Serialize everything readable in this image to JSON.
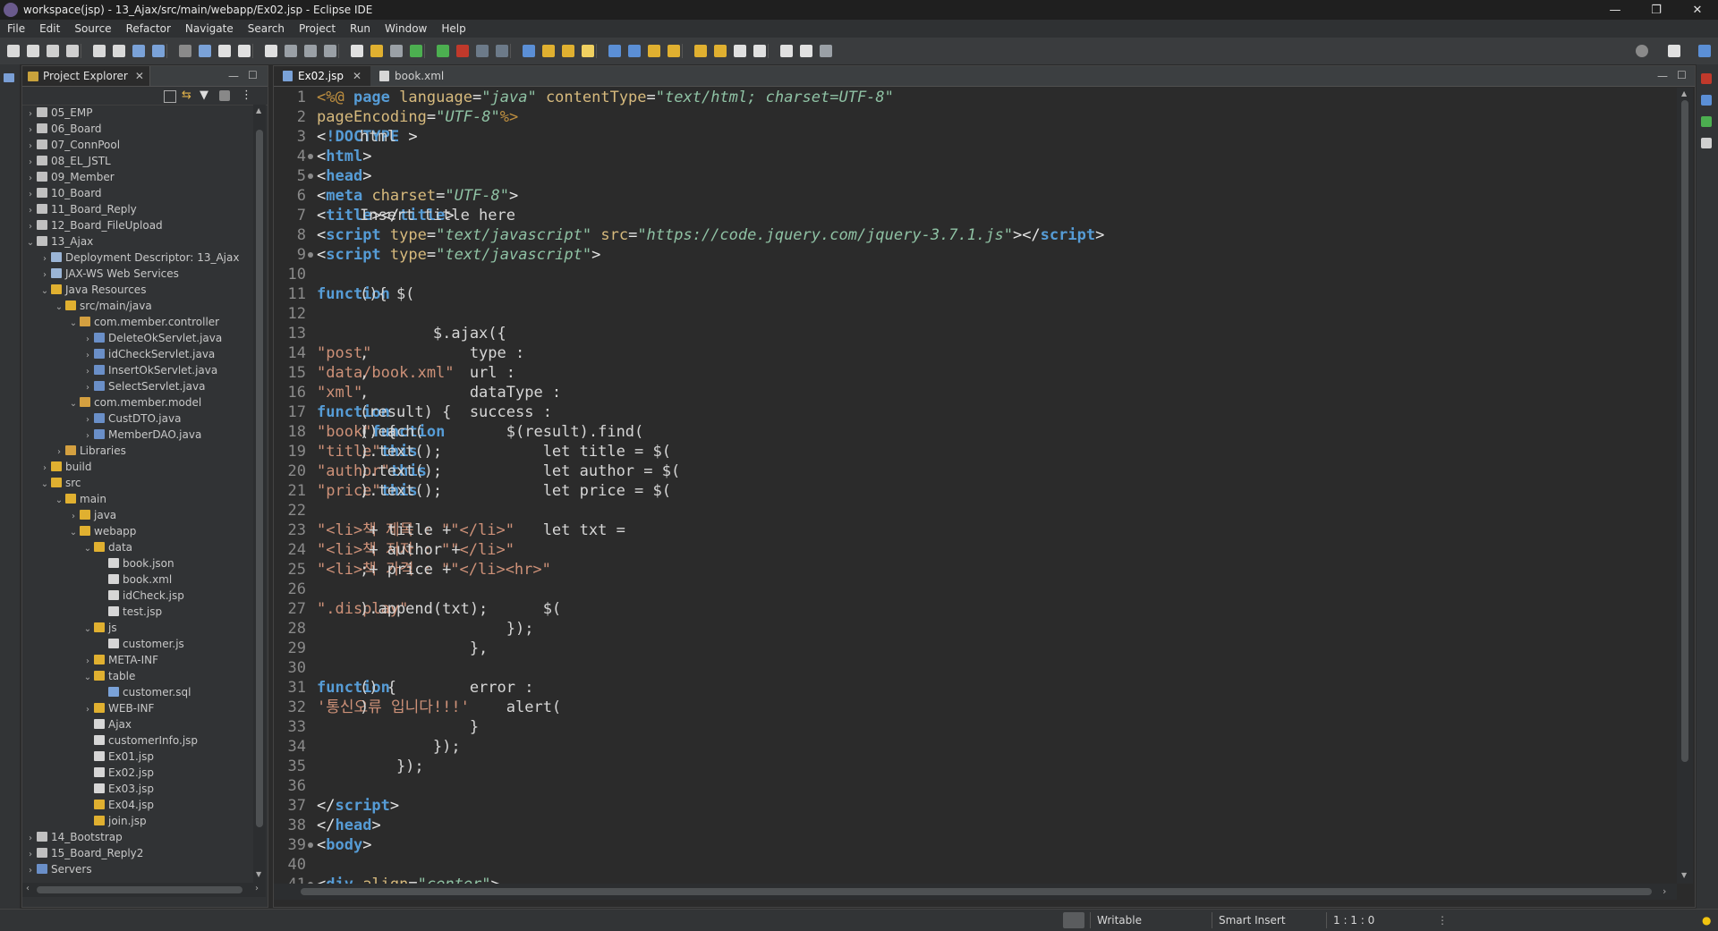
{
  "window": {
    "title": "workspace(jsp) - 13_Ajax/src/main/webapp/Ex02.jsp - Eclipse IDE",
    "minimize": "—",
    "restore": "❐",
    "close": "✕"
  },
  "menu": [
    "File",
    "Edit",
    "Source",
    "Refactor",
    "Navigate",
    "Search",
    "Project",
    "Run",
    "Window",
    "Help"
  ],
  "explorer": {
    "tab_label": "Project Explorer",
    "tree": [
      {
        "label": "05_EMP",
        "depth": 0,
        "arrow": "›",
        "kind": "project"
      },
      {
        "label": "06_Board",
        "depth": 0,
        "arrow": "›",
        "kind": "project"
      },
      {
        "label": "07_ConnPool",
        "depth": 0,
        "arrow": "›",
        "kind": "project"
      },
      {
        "label": "08_EL_JSTL",
        "depth": 0,
        "arrow": "›",
        "kind": "project"
      },
      {
        "label": "09_Member",
        "depth": 0,
        "arrow": "›",
        "kind": "project"
      },
      {
        "label": "10_Board",
        "depth": 0,
        "arrow": "›",
        "kind": "project"
      },
      {
        "label": "11_Board_Reply",
        "depth": 0,
        "arrow": "›",
        "kind": "project"
      },
      {
        "label": "12_Board_FileUpload",
        "depth": 0,
        "arrow": "›",
        "kind": "project"
      },
      {
        "label": "13_Ajax",
        "depth": 0,
        "arrow": "⌄",
        "kind": "project"
      },
      {
        "label": "Deployment Descriptor: 13_Ajax",
        "depth": 1,
        "arrow": "›",
        "kind": "deploy"
      },
      {
        "label": "JAX-WS Web Services",
        "depth": 1,
        "arrow": "›",
        "kind": "ws"
      },
      {
        "label": "Java Resources",
        "depth": 1,
        "arrow": "⌄",
        "kind": "jres"
      },
      {
        "label": "src/main/java",
        "depth": 2,
        "arrow": "⌄",
        "kind": "srcfolder"
      },
      {
        "label": "com.member.controller",
        "depth": 3,
        "arrow": "⌄",
        "kind": "package"
      },
      {
        "label": "DeleteOkServlet.java",
        "depth": 4,
        "arrow": "›",
        "kind": "java"
      },
      {
        "label": "idCheckServlet.java",
        "depth": 4,
        "arrow": "›",
        "kind": "java"
      },
      {
        "label": "InsertOkServlet.java",
        "depth": 4,
        "arrow": "›",
        "kind": "java"
      },
      {
        "label": "SelectServlet.java",
        "depth": 4,
        "arrow": "›",
        "kind": "java"
      },
      {
        "label": "com.member.model",
        "depth": 3,
        "arrow": "⌄",
        "kind": "package"
      },
      {
        "label": "CustDTO.java",
        "depth": 4,
        "arrow": "›",
        "kind": "java"
      },
      {
        "label": "MemberDAO.java",
        "depth": 4,
        "arrow": "›",
        "kind": "java"
      },
      {
        "label": "Libraries",
        "depth": 2,
        "arrow": "›",
        "kind": "lib"
      },
      {
        "label": "build",
        "depth": 1,
        "arrow": "›",
        "kind": "folder"
      },
      {
        "label": "src",
        "depth": 1,
        "arrow": "⌄",
        "kind": "folder"
      },
      {
        "label": "main",
        "depth": 2,
        "arrow": "⌄",
        "kind": "folder"
      },
      {
        "label": "java",
        "depth": 3,
        "arrow": "›",
        "kind": "folder"
      },
      {
        "label": "webapp",
        "depth": 3,
        "arrow": "⌄",
        "kind": "folder"
      },
      {
        "label": "data",
        "depth": 4,
        "arrow": "⌄",
        "kind": "folder"
      },
      {
        "label": "book.json",
        "depth": 5,
        "arrow": "",
        "kind": "file"
      },
      {
        "label": "book.xml",
        "depth": 5,
        "arrow": "",
        "kind": "xml"
      },
      {
        "label": "idCheck.jsp",
        "depth": 5,
        "arrow": "",
        "kind": "file"
      },
      {
        "label": "test.jsp",
        "depth": 5,
        "arrow": "",
        "kind": "file"
      },
      {
        "label": "js",
        "depth": 4,
        "arrow": "⌄",
        "kind": "folder"
      },
      {
        "label": "customer.js",
        "depth": 5,
        "arrow": "",
        "kind": "file"
      },
      {
        "label": "META-INF",
        "depth": 4,
        "arrow": "›",
        "kind": "folder"
      },
      {
        "label": "table",
        "depth": 4,
        "arrow": "⌄",
        "kind": "folder"
      },
      {
        "label": "customer.sql",
        "depth": 5,
        "arrow": "",
        "kind": "sql"
      },
      {
        "label": "WEB-INF",
        "depth": 4,
        "arrow": "›",
        "kind": "folder"
      },
      {
        "label": "Ajax",
        "depth": 4,
        "arrow": "",
        "kind": "file"
      },
      {
        "label": "customerInfo.jsp",
        "depth": 4,
        "arrow": "",
        "kind": "file"
      },
      {
        "label": "Ex01.jsp",
        "depth": 4,
        "arrow": "",
        "kind": "file"
      },
      {
        "label": "Ex02.jsp",
        "depth": 4,
        "arrow": "",
        "kind": "file"
      },
      {
        "label": "Ex03.jsp",
        "depth": 4,
        "arrow": "",
        "kind": "file"
      },
      {
        "label": "Ex04.jsp",
        "depth": 4,
        "arrow": "",
        "kind": "jspwarn"
      },
      {
        "label": "join.jsp",
        "depth": 4,
        "arrow": "",
        "kind": "jspwarn"
      },
      {
        "label": "14_Bootstrap",
        "depth": 0,
        "arrow": "›",
        "kind": "project"
      },
      {
        "label": "15_Board_Reply2",
        "depth": 0,
        "arrow": "›",
        "kind": "project"
      },
      {
        "label": "Servers",
        "depth": 0,
        "arrow": "›",
        "kind": "servers"
      }
    ]
  },
  "editor": {
    "tabs": [
      {
        "label": "Ex02.jsp",
        "active": true
      },
      {
        "label": "book.xml",
        "active": false
      }
    ],
    "lines": [
      {
        "n": "1",
        "fold": false,
        "segs": [
          [
            "jsp",
            "<%@ "
          ],
          [
            "kw",
            "page "
          ],
          [
            "attr",
            "language"
          ],
          [
            "tag",
            "="
          ],
          [
            "aval",
            "\"java\" "
          ],
          [
            "attr",
            "contentType"
          ],
          [
            "tag",
            "="
          ],
          [
            "aval",
            "\"text/html; charset=UTF-8\""
          ]
        ]
      },
      {
        "n": "2",
        "fold": false,
        "segs": [
          [
            "tx",
            "    "
          ],
          [
            "attr",
            "pageEncoding"
          ],
          [
            "tag",
            "="
          ],
          [
            "aval",
            "\"UTF-8\""
          ],
          [
            "jsp",
            "%>"
          ]
        ]
      },
      {
        "n": "3",
        "fold": false,
        "segs": [
          [
            "tag",
            "<"
          ],
          [
            "tagn",
            "!DOCTYPE "
          ],
          [
            "tx",
            "html"
          ],
          [
            "tag",
            ">"
          ]
        ]
      },
      {
        "n": "4",
        "fold": true,
        "segs": [
          [
            "tag",
            "<"
          ],
          [
            "tagn",
            "html"
          ],
          [
            "tag",
            ">"
          ]
        ]
      },
      {
        "n": "5",
        "fold": true,
        "segs": [
          [
            "tag",
            "<"
          ],
          [
            "tagn",
            "head"
          ],
          [
            "tag",
            ">"
          ]
        ]
      },
      {
        "n": "6",
        "fold": false,
        "segs": [
          [
            "tag",
            "<"
          ],
          [
            "tagn",
            "meta "
          ],
          [
            "attr",
            "charset"
          ],
          [
            "tag",
            "="
          ],
          [
            "aval",
            "\"UTF-8\""
          ],
          [
            "tag",
            ">"
          ]
        ]
      },
      {
        "n": "7",
        "fold": false,
        "segs": [
          [
            "tag",
            "<"
          ],
          [
            "tagn",
            "title"
          ],
          [
            "tag",
            ">"
          ],
          [
            "tx",
            "Insert title here"
          ],
          [
            "tag",
            "</"
          ],
          [
            "tagn",
            "title"
          ],
          [
            "tag",
            ">"
          ]
        ]
      },
      {
        "n": "8",
        "fold": false,
        "segs": [
          [
            "tag",
            "<"
          ],
          [
            "tagn",
            "script "
          ],
          [
            "attr",
            "type"
          ],
          [
            "tag",
            "="
          ],
          [
            "aval",
            "\"text/javascript\" "
          ],
          [
            "attr",
            "src"
          ],
          [
            "tag",
            "="
          ],
          [
            "aval",
            "\"https://code.jquery.com/jquery-3.7.1.js\""
          ],
          [
            "tag",
            "></"
          ],
          [
            "tagn",
            "script"
          ],
          [
            "tag",
            ">"
          ]
        ]
      },
      {
        "n": "9",
        "fold": true,
        "segs": [
          [
            "tag",
            "<"
          ],
          [
            "tagn",
            "script "
          ],
          [
            "attr",
            "type"
          ],
          [
            "tag",
            "="
          ],
          [
            "aval",
            "\"text/javascript\""
          ],
          [
            "tag",
            ">"
          ]
        ]
      },
      {
        "n": "10",
        "fold": false,
        "segs": []
      },
      {
        "n": "11",
        "fold": false,
        "segs": [
          [
            "tx",
            "    $("
          ],
          [
            "kw",
            "function"
          ],
          [
            "tx",
            "(){"
          ]
        ]
      },
      {
        "n": "12",
        "fold": false,
        "segs": []
      },
      {
        "n": "13",
        "fold": false,
        "segs": [
          [
            "tx",
            "        $.ajax({"
          ]
        ]
      },
      {
        "n": "14",
        "fold": false,
        "segs": [
          [
            "tx",
            "            type : "
          ],
          [
            "str",
            "\"post\""
          ],
          [
            "tx",
            ","
          ]
        ]
      },
      {
        "n": "15",
        "fold": false,
        "segs": [
          [
            "tx",
            "            url : "
          ],
          [
            "str",
            "\"data/book.xml\""
          ],
          [
            "tx",
            ","
          ]
        ]
      },
      {
        "n": "16",
        "fold": false,
        "segs": [
          [
            "tx",
            "            dataType : "
          ],
          [
            "str",
            "\"xml\""
          ],
          [
            "tx",
            ","
          ]
        ]
      },
      {
        "n": "17",
        "fold": false,
        "segs": [
          [
            "tx",
            "            success : "
          ],
          [
            "kw",
            "function"
          ],
          [
            "tx",
            "(result) {"
          ]
        ]
      },
      {
        "n": "18",
        "fold": false,
        "segs": [
          [
            "tx",
            "                $(result).find("
          ],
          [
            "str",
            "\"book\""
          ],
          [
            "tx",
            ").each("
          ],
          [
            "kw",
            "function"
          ],
          [
            "tx",
            "() {"
          ]
        ]
      },
      {
        "n": "19",
        "fold": false,
        "segs": [
          [
            "tx",
            "                    let title = $("
          ],
          [
            "str",
            "\"title\""
          ],
          [
            "tx",
            ", "
          ],
          [
            "kw",
            "this"
          ],
          [
            "tx",
            ").text();"
          ]
        ]
      },
      {
        "n": "20",
        "fold": false,
        "segs": [
          [
            "tx",
            "                    let author = $("
          ],
          [
            "str",
            "\"author\""
          ],
          [
            "tx",
            ", "
          ],
          [
            "kw",
            "this"
          ],
          [
            "tx",
            ").text();"
          ]
        ]
      },
      {
        "n": "21",
        "fold": false,
        "segs": [
          [
            "tx",
            "                    let price = $("
          ],
          [
            "str",
            "\"price\""
          ],
          [
            "tx",
            ", "
          ],
          [
            "kw",
            "this"
          ],
          [
            "tx",
            ").text();"
          ]
        ]
      },
      {
        "n": "22",
        "fold": false,
        "segs": []
      },
      {
        "n": "23",
        "fold": false,
        "segs": [
          [
            "tx",
            "                    let txt = "
          ],
          [
            "str",
            "\"<li>책 제목 : \""
          ],
          [
            "tx",
            " + title + "
          ],
          [
            "str",
            "\"</li>\""
          ],
          [
            "tx",
            " +"
          ]
        ]
      },
      {
        "n": "24",
        "fold": false,
        "segs": [
          [
            "tx",
            "                              "
          ],
          [
            "str",
            "\"<li>책 저자 : \""
          ],
          [
            "tx",
            " + author + "
          ],
          [
            "str",
            "\"</li>\""
          ],
          [
            "tx",
            " +"
          ]
        ]
      },
      {
        "n": "25",
        "fold": false,
        "segs": [
          [
            "tx",
            "                              "
          ],
          [
            "str",
            "\"<li>책 가격 : \""
          ],
          [
            "tx",
            " + price + "
          ],
          [
            "str",
            "\"</li><hr>\""
          ],
          [
            "tx",
            ";"
          ]
        ]
      },
      {
        "n": "26",
        "fold": false,
        "segs": []
      },
      {
        "n": "27",
        "fold": false,
        "segs": [
          [
            "tx",
            "                    $("
          ],
          [
            "str",
            "\".display\""
          ],
          [
            "tx",
            ").append(txt);"
          ]
        ]
      },
      {
        "n": "28",
        "fold": false,
        "segs": [
          [
            "tx",
            "                });"
          ]
        ]
      },
      {
        "n": "29",
        "fold": false,
        "segs": [
          [
            "tx",
            "            },"
          ]
        ]
      },
      {
        "n": "30",
        "fold": false,
        "segs": []
      },
      {
        "n": "31",
        "fold": false,
        "segs": [
          [
            "tx",
            "            error : "
          ],
          [
            "kw",
            "function"
          ],
          [
            "tx",
            "() {"
          ]
        ]
      },
      {
        "n": "32",
        "fold": false,
        "segs": [
          [
            "tx",
            "                alert("
          ],
          [
            "str",
            "'통신오류 입니다!!!'"
          ],
          [
            "tx",
            ")"
          ]
        ]
      },
      {
        "n": "33",
        "fold": false,
        "segs": [
          [
            "tx",
            "            }"
          ]
        ]
      },
      {
        "n": "34",
        "fold": false,
        "segs": [
          [
            "tx",
            "        });"
          ]
        ]
      },
      {
        "n": "35",
        "fold": false,
        "segs": [
          [
            "tx",
            "    });"
          ]
        ]
      },
      {
        "n": "36",
        "fold": false,
        "segs": []
      },
      {
        "n": "37",
        "fold": false,
        "segs": [
          [
            "tag",
            "</"
          ],
          [
            "tagn",
            "script"
          ],
          [
            "tag",
            ">"
          ]
        ]
      },
      {
        "n": "38",
        "fold": false,
        "segs": [
          [
            "tag",
            "</"
          ],
          [
            "tagn",
            "head"
          ],
          [
            "tag",
            ">"
          ]
        ]
      },
      {
        "n": "39",
        "fold": true,
        "segs": [
          [
            "tag",
            "<"
          ],
          [
            "tagn",
            "body"
          ],
          [
            "tag",
            ">"
          ]
        ]
      },
      {
        "n": "40",
        "fold": false,
        "segs": []
      },
      {
        "n": "41",
        "fold": true,
        "segs": [
          [
            "tx",
            "    "
          ],
          [
            "tag",
            "<"
          ],
          [
            "tagn",
            "div "
          ],
          [
            "attr",
            "align"
          ],
          [
            "tag",
            "="
          ],
          [
            "aval",
            "\"center\""
          ],
          [
            "tag",
            ">"
          ]
        ]
      }
    ]
  },
  "status": {
    "mode": "Writable",
    "insert": "Smart Insert",
    "position": "1 : 1 : 0"
  },
  "colors": {
    "accent": "#569cd6",
    "string": "#ce9178",
    "attr_value": "#8fc2a4",
    "attr_name": "#d7ba7d"
  }
}
